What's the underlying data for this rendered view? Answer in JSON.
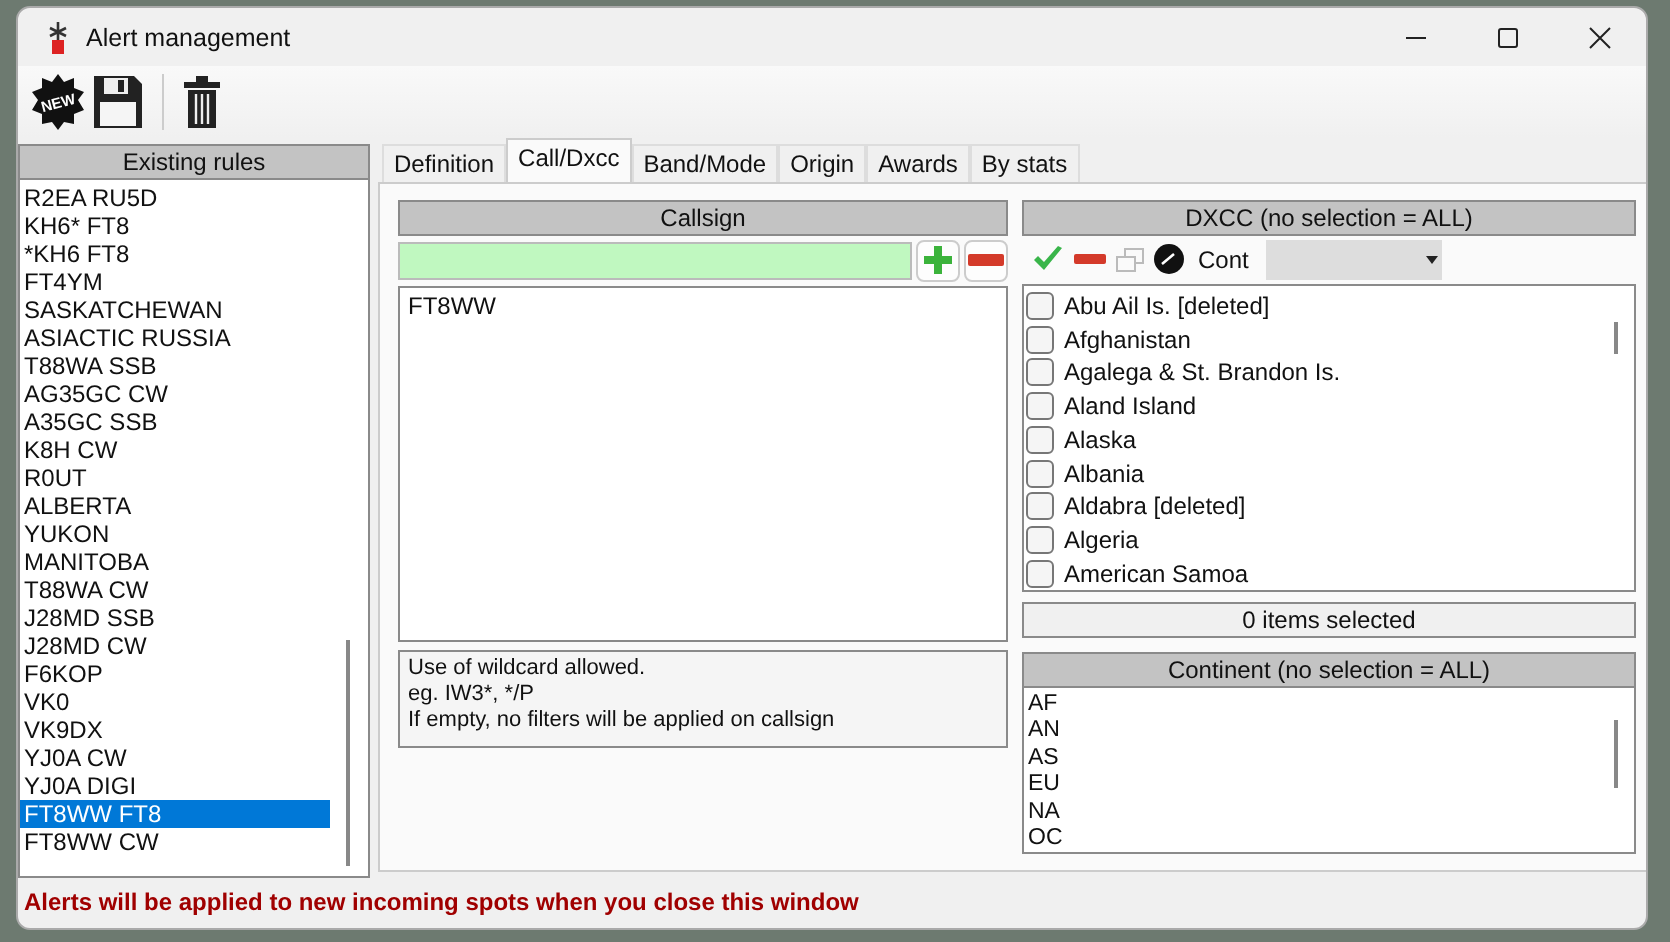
{
  "window": {
    "title": "Alert management"
  },
  "toolbar": {
    "new_badge": "NEW"
  },
  "rules": {
    "header": "Existing rules",
    "items": [
      {
        "label": "R2EA RU5D",
        "selected": false
      },
      {
        "label": "KH6* FT8",
        "selected": false
      },
      {
        "label": "*KH6 FT8",
        "selected": false
      },
      {
        "label": "FT4YM",
        "selected": false
      },
      {
        "label": "SASKATCHEWAN",
        "selected": false
      },
      {
        "label": "ASIACTIC RUSSIA",
        "selected": false
      },
      {
        "label": "T88WA SSB",
        "selected": false
      },
      {
        "label": "AG35GC CW",
        "selected": false
      },
      {
        "label": "A35GC SSB",
        "selected": false
      },
      {
        "label": "K8H CW",
        "selected": false
      },
      {
        "label": "R0UT",
        "selected": false
      },
      {
        "label": "ALBERTA",
        "selected": false
      },
      {
        "label": "YUKON",
        "selected": false
      },
      {
        "label": "MANITOBA",
        "selected": false
      },
      {
        "label": "T88WA CW",
        "selected": false
      },
      {
        "label": "J28MD SSB",
        "selected": false
      },
      {
        "label": "J28MD CW",
        "selected": false
      },
      {
        "label": "F6KOP",
        "selected": false
      },
      {
        "label": "VK0",
        "selected": false
      },
      {
        "label": "VK9DX",
        "selected": false
      },
      {
        "label": "YJ0A CW",
        "selected": false
      },
      {
        "label": "YJ0A DIGI",
        "selected": false
      },
      {
        "label": "FT8WW FT8",
        "selected": true
      },
      {
        "label": "FT8WW CW",
        "selected": false
      }
    ]
  },
  "tabs": [
    {
      "label": "Definition",
      "selected": false
    },
    {
      "label": "Call/Dxcc",
      "selected": true
    },
    {
      "label": "Band/Mode",
      "selected": false
    },
    {
      "label": "Origin",
      "selected": false
    },
    {
      "label": "Awards",
      "selected": false
    },
    {
      "label": "By stats",
      "selected": false
    }
  ],
  "callsign": {
    "header": "Callsign",
    "items": [
      "FT8WW"
    ],
    "hint": [
      "Use of wildcard allowed.",
      "eg. IW3*, */P",
      "If empty, no filters will be applied on callsign"
    ]
  },
  "dxcc": {
    "header": "DXCC (no selection = ALL)",
    "cont_label": "Cont",
    "items": [
      {
        "label": "Abu Ail Is. [deleted]",
        "checked": false
      },
      {
        "label": "Afghanistan",
        "checked": false
      },
      {
        "label": "Agalega & St. Brandon Is.",
        "checked": false
      },
      {
        "label": "Aland Island",
        "checked": false
      },
      {
        "label": "Alaska",
        "checked": false
      },
      {
        "label": "Albania",
        "checked": false
      },
      {
        "label": "Aldabra [deleted]",
        "checked": false
      },
      {
        "label": "Algeria",
        "checked": false
      },
      {
        "label": "American Samoa",
        "checked": false
      }
    ],
    "status": "0 items selected"
  },
  "continent": {
    "header": "Continent (no selection = ALL)",
    "items": [
      "AF",
      "AN",
      "AS",
      "EU",
      "NA",
      "OC"
    ]
  },
  "status_bar": "Alerts will be applied to new incoming spots when you close this window"
}
